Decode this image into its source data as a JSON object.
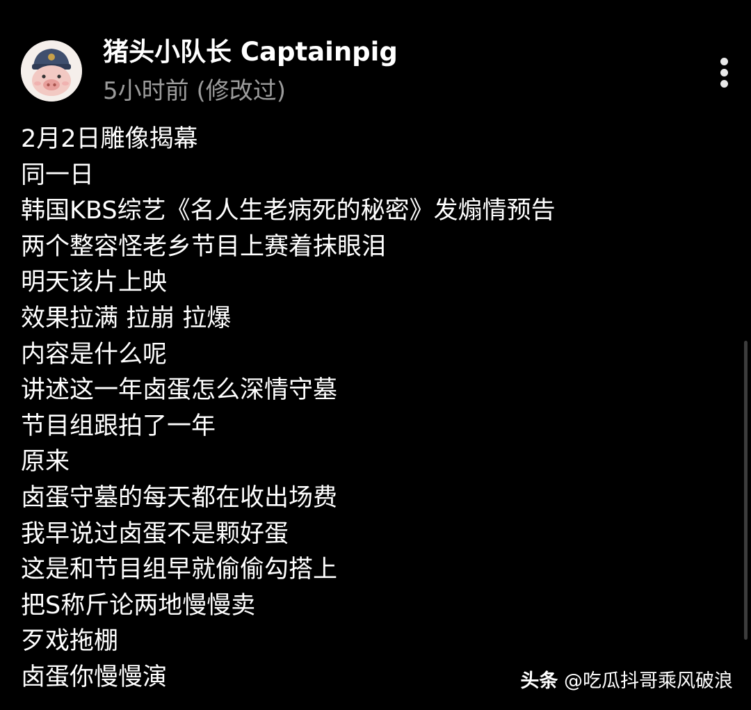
{
  "post": {
    "author": {
      "name": "猪头小队长 Captainpig",
      "avatar_icon": "pig-with-cap-avatar"
    },
    "timestamp": "5小时前 (修改过)",
    "more_icon": "vertical-dots-icon",
    "lines": [
      "2月2日雕像揭幕",
      "同一日",
      "韩国KBS综艺《名人生老病死的秘密》发煽情预告",
      "两个整容怪老乡节目上赛着抹眼泪",
      "明天该片上映",
      "效果拉满 拉崩 拉爆",
      "内容是什么呢",
      "讲述这一年卤蛋怎么深情守墓",
      "节目组跟拍了一年",
      "原来",
      "卤蛋守墓的每天都在收出场费",
      "我早说过卤蛋不是颗好蛋",
      "这是和节目组早就偷偷勾搭上",
      "把S称斤论两地慢慢卖",
      "歹戏拖棚",
      "卤蛋你慢慢演"
    ]
  },
  "watermark": {
    "brand": "头条",
    "handle": "@吃瓜抖哥乘风破浪"
  },
  "colors": {
    "background": "#000000",
    "text": "#ffffff",
    "secondary_text": "#9c9c9c",
    "scrollbar_thumb": "#3c3c3c"
  }
}
